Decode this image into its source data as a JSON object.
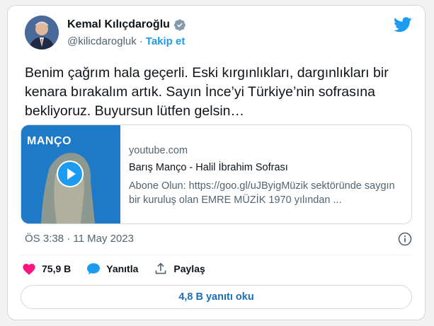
{
  "author": {
    "name": "Kemal Kılıçdaroğlu",
    "handle": "@kilicdarogluk",
    "follow_label": "Takip et"
  },
  "tweet": {
    "text": "Benim çağrım hala geçerli. Eski kırgınlıkları, dargınlıkları bir kenara bırakalım artık. Sayın İnce’yi Türkiye’nin sofrasına bekliyoruz. Buyursun lütfen gelsin…",
    "timestamp": "ÖS 3:38 · 11 May 2023"
  },
  "link_card": {
    "domain": "youtube.com",
    "title": "Barış Manço - Halil İbrahim Sofrası",
    "description": "Abone Olun: https://goo.gl/uJByigMüzik sektöründe saygın bir kuruluş olan EMRE MÜZİK 1970 yılından ...",
    "thumbnail_title": "MANÇO"
  },
  "actions": {
    "like_count": "75,9 B",
    "reply_label": "Yanıtla",
    "share_label": "Paylaş"
  },
  "replies_button": "4,8 B yanıtı oku",
  "colors": {
    "accent": "#1d9bf0",
    "like": "#f91880"
  },
  "icons": [
    "verified-icon",
    "twitter-bird-icon",
    "play-icon",
    "info-icon",
    "heart-icon",
    "reply-icon",
    "share-icon"
  ]
}
